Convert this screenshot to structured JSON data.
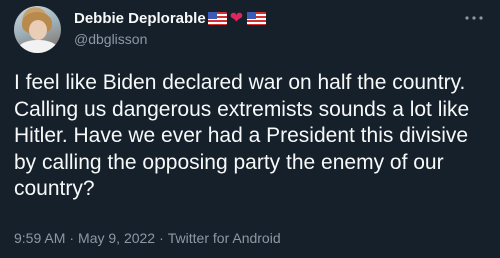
{
  "author": {
    "display_name": "Debbie Deplorable",
    "handle": "@dbglisson",
    "name_emojis": [
      "us-flag-icon",
      "red-heart-icon",
      "us-flag-icon"
    ]
  },
  "tweet": {
    "text": "I feel like Biden declared war on half the country. Calling us dangerous extremists sounds a lot like Hitler. Have we ever had a President this divisive by calling the opposing party the enemy of our country?",
    "time": "9:59 AM",
    "date": "May 9, 2022",
    "source": "Twitter for Android",
    "separator": "·"
  },
  "colors": {
    "background": "#15202b",
    "text": "#f7f9f9",
    "secondary": "#8b98a5",
    "heart": "#e0245e"
  }
}
